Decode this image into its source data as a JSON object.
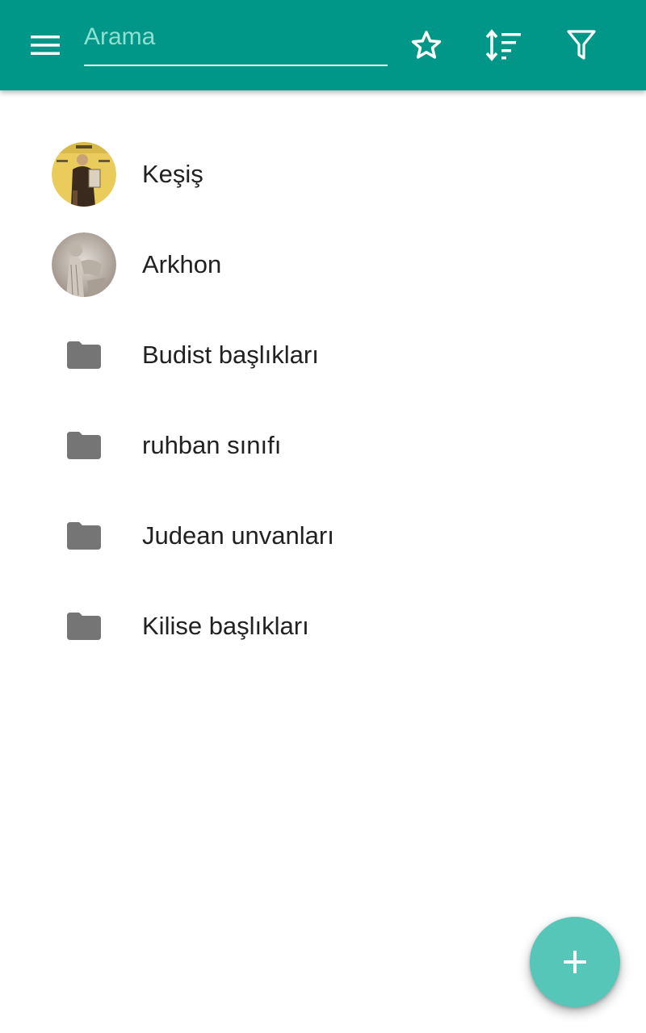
{
  "toolbar": {
    "background": "#009688",
    "menu_icon": "menu-icon",
    "search": {
      "placeholder": "Arama",
      "value": ""
    },
    "actions": [
      {
        "name": "favorite",
        "icon": "star-outline-icon"
      },
      {
        "name": "sort",
        "icon": "sort-icon"
      },
      {
        "name": "filter",
        "icon": "filter-icon"
      }
    ]
  },
  "list": {
    "items": [
      {
        "label": "Keşiş",
        "type": "entry",
        "icon": "monk-avatar"
      },
      {
        "label": "Arkhon",
        "type": "entry",
        "icon": "archon-avatar"
      },
      {
        "label": "Budist başlıkları",
        "type": "folder",
        "icon": "folder-icon"
      },
      {
        "label": "ruhban sınıfı",
        "type": "folder",
        "icon": "folder-icon"
      },
      {
        "label": "Judean unvanları",
        "type": "folder",
        "icon": "folder-icon"
      },
      {
        "label": "Kilise başlıkları",
        "type": "folder",
        "icon": "folder-icon"
      }
    ]
  },
  "fab": {
    "icon": "plus-icon",
    "color": "#55c6b7"
  }
}
